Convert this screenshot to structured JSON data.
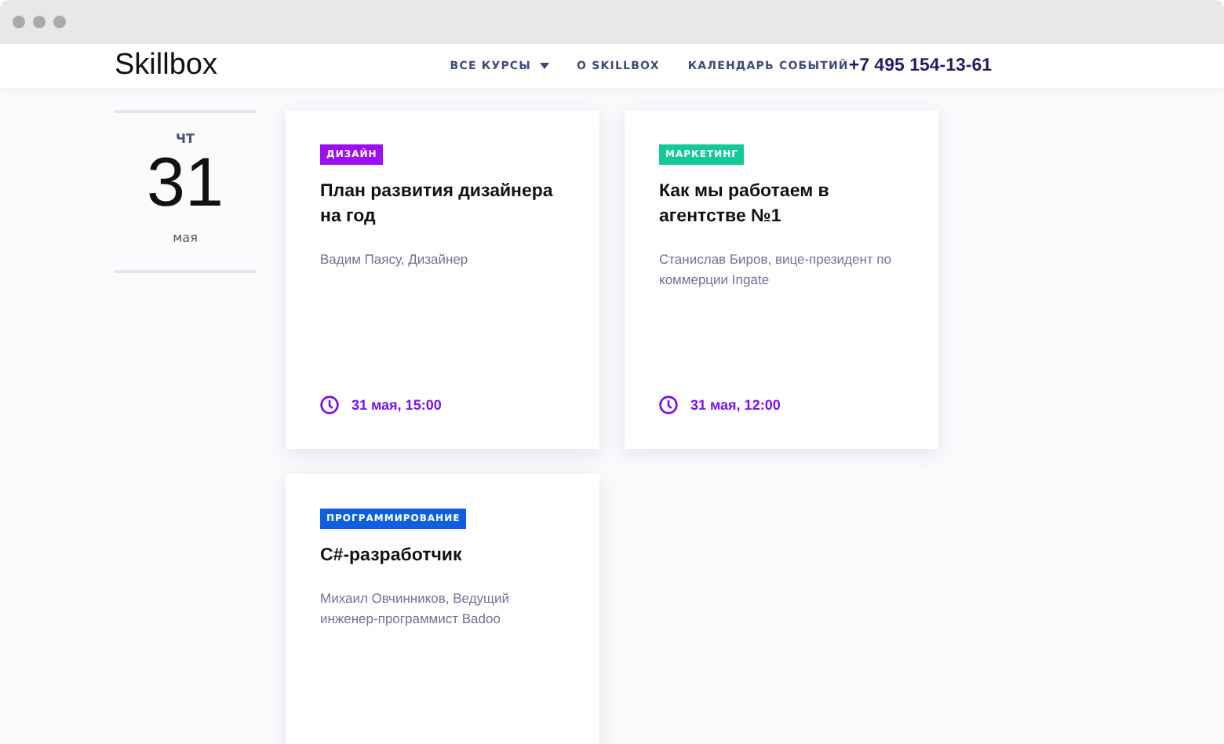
{
  "logo": "Skillbox",
  "nav": [
    {
      "label": "ВСЕ КУРСЫ",
      "dropdown": true
    },
    {
      "label": "О SKILLBOX",
      "dropdown": false
    },
    {
      "label": "КАЛЕНДАРЬ СОБЫТИЙ",
      "dropdown": false
    }
  ],
  "phone": "+7 495 154-13-61",
  "date": {
    "weekday": "ЧТ",
    "day": "31",
    "month": "мая"
  },
  "events": [
    {
      "tag": "ДИЗАЙН",
      "color": "#9b0ff3",
      "title": "План развития дизайнера на год",
      "speaker": "Вадим Паясу, Дизайнер",
      "time": "31 мая, 15:00"
    },
    {
      "tag": "МАРКЕТИНГ",
      "color": "#13c99a",
      "title": "Как мы работаем в агентстве №1",
      "speaker": "Станислав Биров, вице-президент по коммерции Ingate",
      "time": "31 мая, 12:00"
    },
    {
      "tag": "ПРОГРАММИРОВАНИЕ",
      "color": "#0d5fe0",
      "title": "C#-разработчик",
      "speaker": "Михаил Овчинников, Ведущий инженер-программист Badoo"
    }
  ]
}
